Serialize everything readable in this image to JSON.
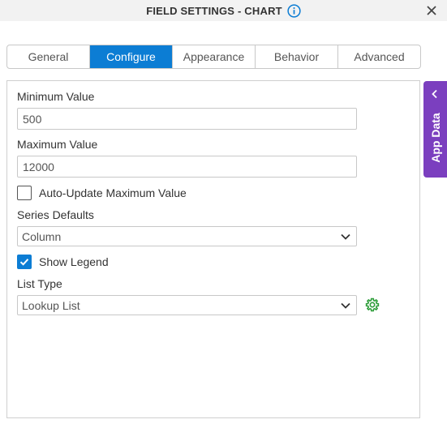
{
  "dialog": {
    "title": "FIELD SETTINGS - CHART"
  },
  "tabs": [
    {
      "label": "General",
      "active": false
    },
    {
      "label": "Configure",
      "active": true
    },
    {
      "label": "Appearance",
      "active": false
    },
    {
      "label": "Behavior",
      "active": false
    },
    {
      "label": "Advanced",
      "active": false
    }
  ],
  "form": {
    "minimum_value": {
      "label": "Minimum Value",
      "value": "500"
    },
    "maximum_value": {
      "label": "Maximum Value",
      "value": "12000"
    },
    "auto_update": {
      "label": "Auto-Update Maximum Value",
      "checked": false
    },
    "series_defaults": {
      "label": "Series Defaults",
      "selected": "Column"
    },
    "show_legend": {
      "label": "Show Legend",
      "checked": true
    },
    "list_type": {
      "label": "List Type",
      "selected": "Lookup List"
    }
  },
  "side_panel": {
    "label": "App Data"
  },
  "colors": {
    "accent": "#0c7dd4",
    "app_data_tab": "#7b3fbf",
    "gear_icon": "#2e9e3a"
  },
  "icons": {
    "info": "info-circle-icon",
    "close": "close-icon",
    "chevron": "chevron-down-icon",
    "gear": "gear-icon",
    "app_data_chevron": "chevron-left-icon"
  }
}
